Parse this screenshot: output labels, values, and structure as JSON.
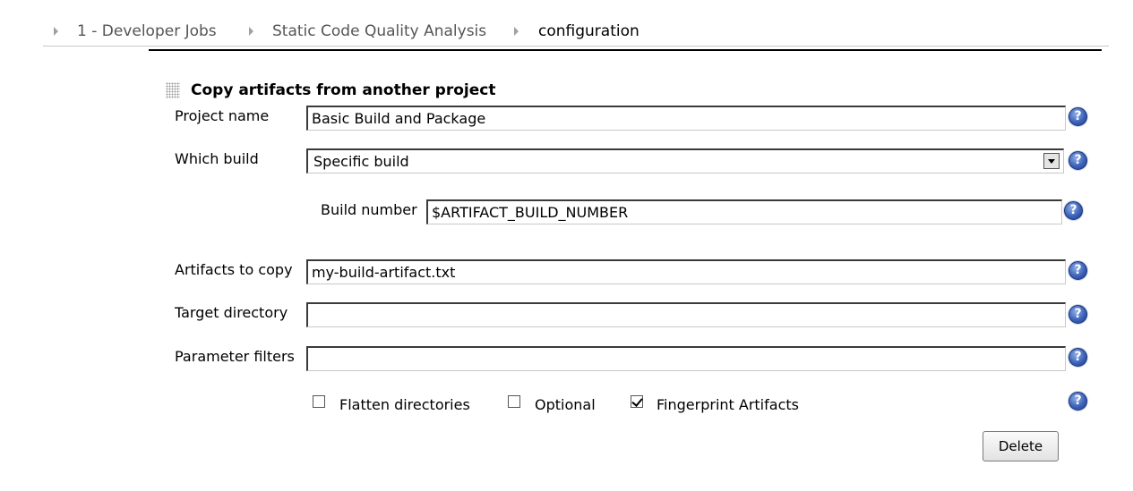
{
  "breadcrumb": {
    "items": [
      "1 - Developer Jobs",
      "Static Code Quality Analysis",
      "configuration"
    ]
  },
  "section": {
    "title": "Copy artifacts from another project"
  },
  "form": {
    "project_name": {
      "label": "Project name",
      "value": "Basic Build and Package"
    },
    "which_build": {
      "label": "Which build",
      "value": "Specific build"
    },
    "build_number": {
      "label": "Build number",
      "value": "$ARTIFACT_BUILD_NUMBER"
    },
    "artifacts_to_copy": {
      "label": "Artifacts to copy",
      "value": "my-build-artifact.txt"
    },
    "target_directory": {
      "label": "Target directory",
      "value": ""
    },
    "parameter_filters": {
      "label": "Parameter filters",
      "value": ""
    }
  },
  "options": {
    "flatten": {
      "label": "Flatten directories",
      "checked": false
    },
    "optional": {
      "label": "Optional",
      "checked": false
    },
    "fingerprint": {
      "label": "Fingerprint Artifacts",
      "checked": true
    }
  },
  "help_icon_glyph": "?",
  "delete_button": {
    "label": "Delete"
  },
  "colors": {
    "help_icon": "#3d62b8",
    "breadcrumb_text": "#555555"
  },
  "icons": [
    "breadcrumb-arrow-icon",
    "drag-grip-icon",
    "help-icon",
    "dropdown-arrow-icon",
    "checkbox-icon"
  ]
}
